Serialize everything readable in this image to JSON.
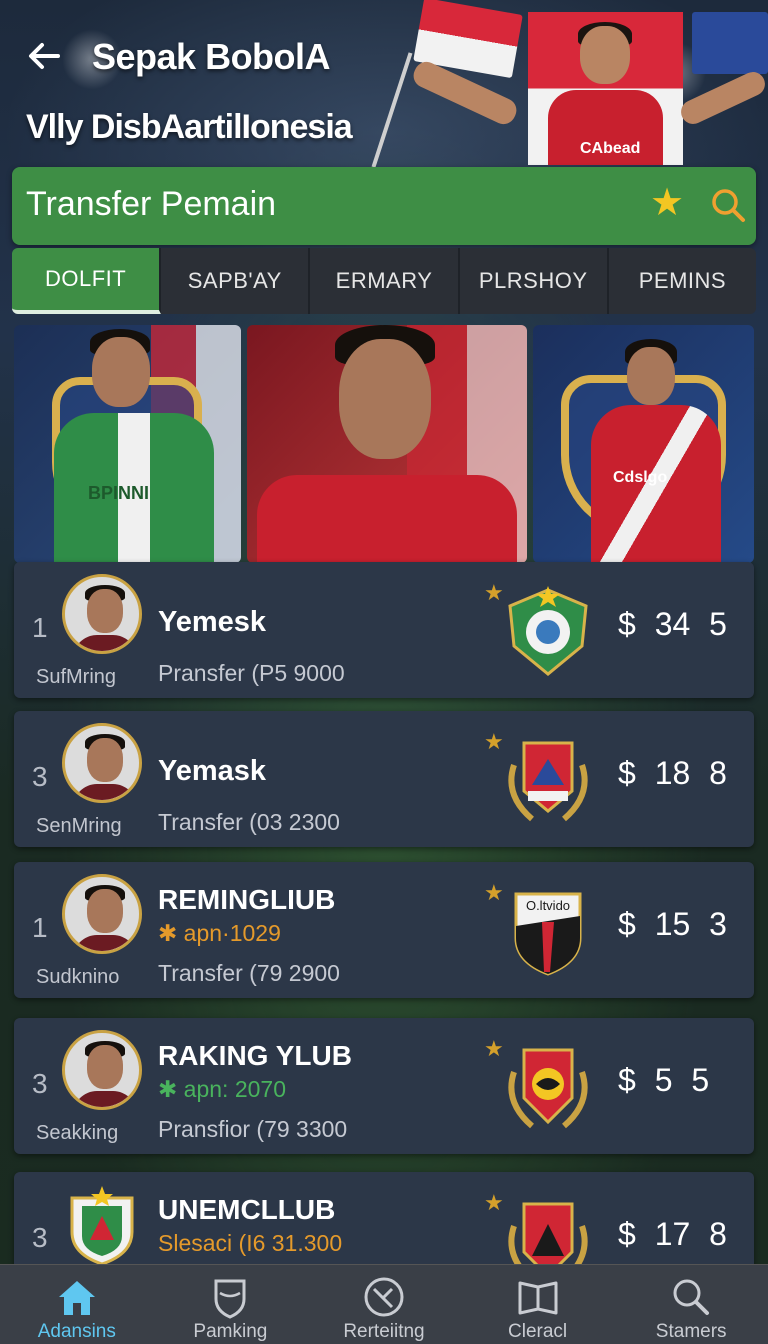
{
  "header": {
    "back_icon": "back-arrow-icon",
    "title": "Sepak BobolA",
    "subtitle": "Vlly DisbAartilIonesia",
    "hero_shirt_text": "CAbead"
  },
  "section": {
    "title": "Transfer Pemain",
    "star_icon": "star-icon",
    "search_icon": "search-icon"
  },
  "tabs": [
    {
      "label": "DOLFIT",
      "active": true
    },
    {
      "label": "SAPB'AY",
      "active": false
    },
    {
      "label": "ERMARY",
      "active": false
    },
    {
      "label": "PLRSHOY",
      "active": false
    },
    {
      "label": "PEMINS",
      "active": false
    }
  ],
  "featured": {
    "card1_text": "BPINNI",
    "card3_text": "Cdslgo"
  },
  "transfers": [
    {
      "rank": "1",
      "name": "Yemesk",
      "role": "SufMring",
      "meta": "Pransfer (P5 9000",
      "fee": "",
      "price": "$ 34 5"
    },
    {
      "rank": "3",
      "name": "Yemask",
      "role": "SenMring",
      "meta": "Transfer (03 2300",
      "fee": "",
      "price": "$ 18 8"
    },
    {
      "rank": "1",
      "name": "REMINGLIUB",
      "role": "Sudknino",
      "meta": "Transfer (79 2900",
      "fee": "✱ apn·1029",
      "price": "$ 15 3"
    },
    {
      "rank": "3",
      "name": "RAKING YLUB",
      "role": "Seakking",
      "meta": "Pransfior (79 3300",
      "fee": "✱ apn: 2070",
      "price": "$ 5 5"
    },
    {
      "rank": "3",
      "name": "UNEMCLLUB",
      "role": "",
      "meta": "",
      "fee": "Slesaci (I6 31.300",
      "price": "$ 17 8"
    }
  ],
  "crest_texts": {
    "crest3": "O.ltvido"
  },
  "bottom_nav": [
    {
      "label": "Adansins",
      "icon": "home-icon",
      "active": true
    },
    {
      "label": "Pamking",
      "icon": "shield-icon",
      "active": false
    },
    {
      "label": "Rerteiitng",
      "icon": "ball-icon",
      "active": false
    },
    {
      "label": "Cleracl",
      "icon": "book-icon",
      "active": false
    },
    {
      "label": "Stamers",
      "icon": "search-icon",
      "active": false
    }
  ],
  "colors": {
    "accent_green": "#3e8e45",
    "active_nav": "#5fc7f0",
    "star": "#f3c623",
    "card_bg": "#2c3748"
  }
}
